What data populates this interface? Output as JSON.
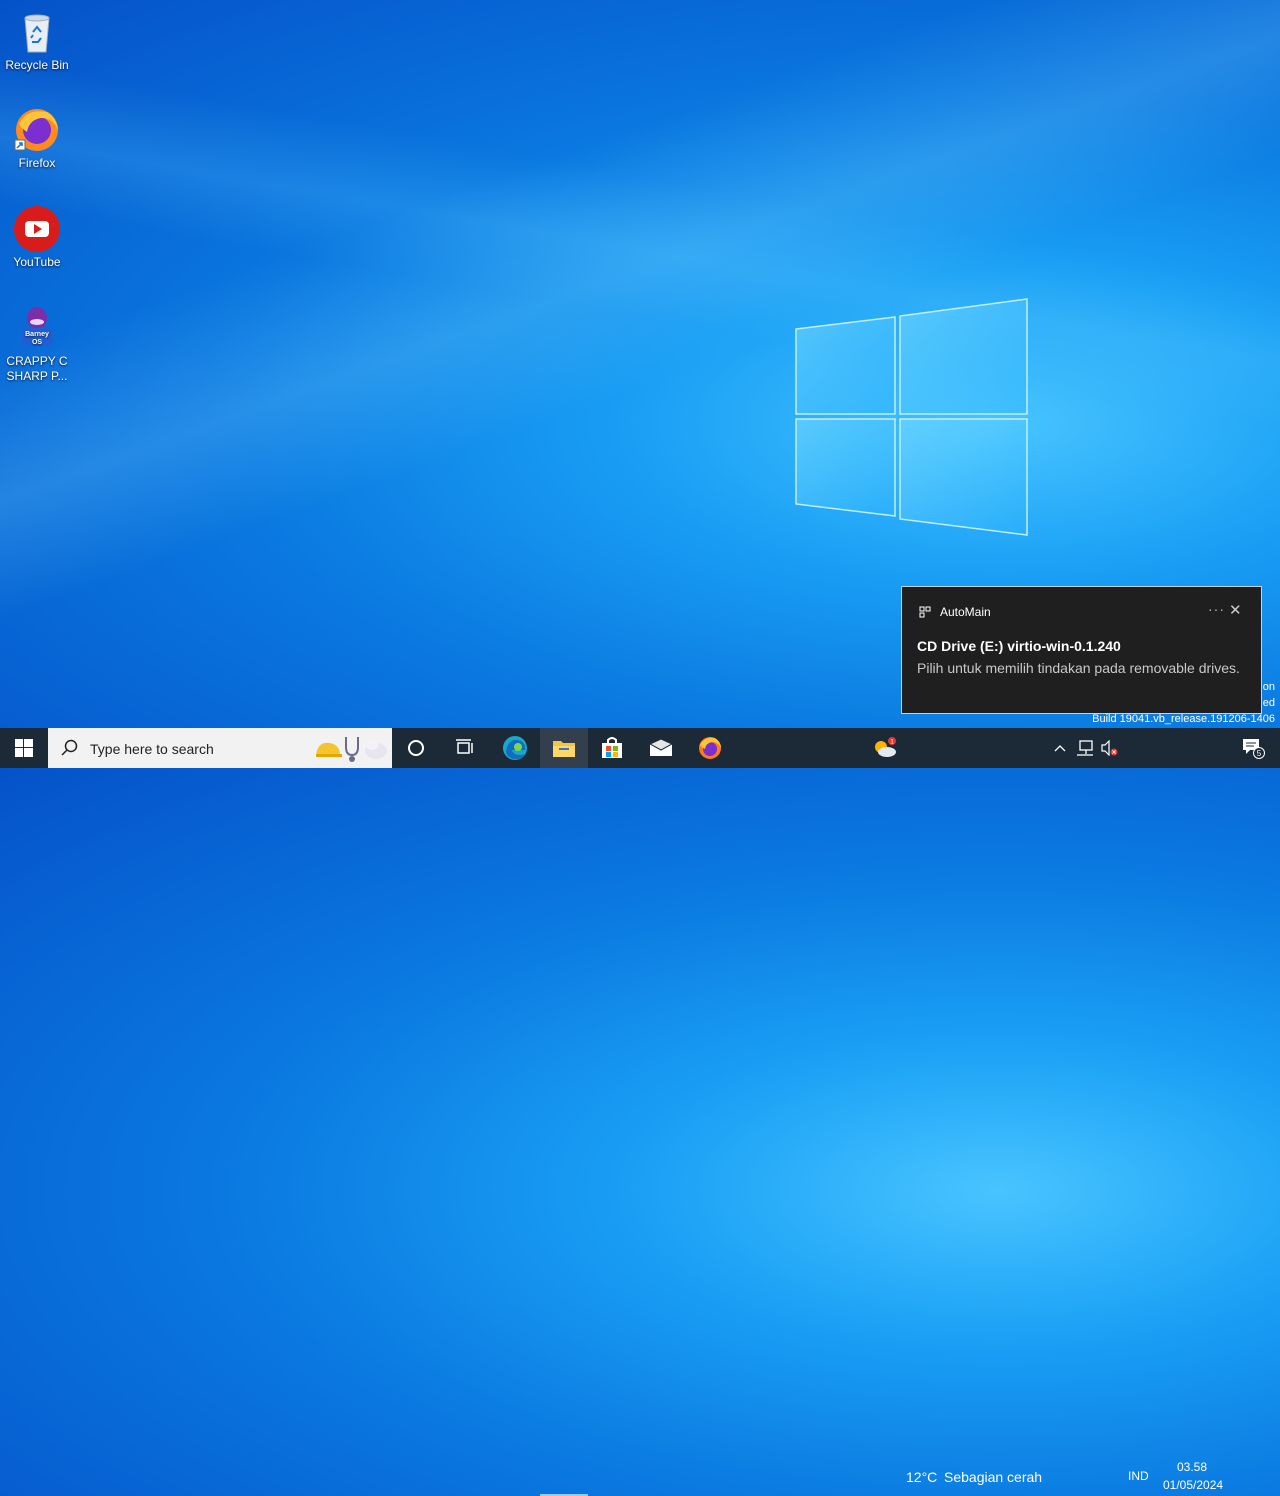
{
  "desktop": {
    "icons": [
      {
        "label": "Recycle Bin",
        "icon": "recycle-bin-icon"
      },
      {
        "label": "Firefox",
        "icon": "firefox-icon"
      },
      {
        "label": "YouTube",
        "icon": "youtube-icon"
      },
      {
        "label": "CRAPPY C SHARP P...",
        "icon": "barney-app-icon",
        "badge": "Barney OS"
      }
    ],
    "watermark": {
      "line1": "on",
      "line2": "ed",
      "build": "Build 19041.vb_release.191206-1406"
    }
  },
  "toast": {
    "app_name": "AutoMain",
    "title": "CD Drive (E:) virtio-win-0.1.240",
    "body": "Pilih untuk memilih tindakan pada removable drives.",
    "more_label": "···",
    "close_label": "✕"
  },
  "taskbar": {
    "search_placeholder": "Type here to search",
    "weather": {
      "temp": "12°C",
      "condition": "Sebagian cerah",
      "alert_count": "1"
    },
    "language": "IND",
    "time": "03.58",
    "date": "01/05/2024",
    "notification_count": "5",
    "pinned": [
      "task-view",
      "edge",
      "file-explorer",
      "microsoft-store",
      "mail",
      "firefox"
    ]
  },
  "colors": {
    "taskbar": "#1c2a38",
    "accent": "#0078d7",
    "toast_bg": "#1f1f1f"
  }
}
